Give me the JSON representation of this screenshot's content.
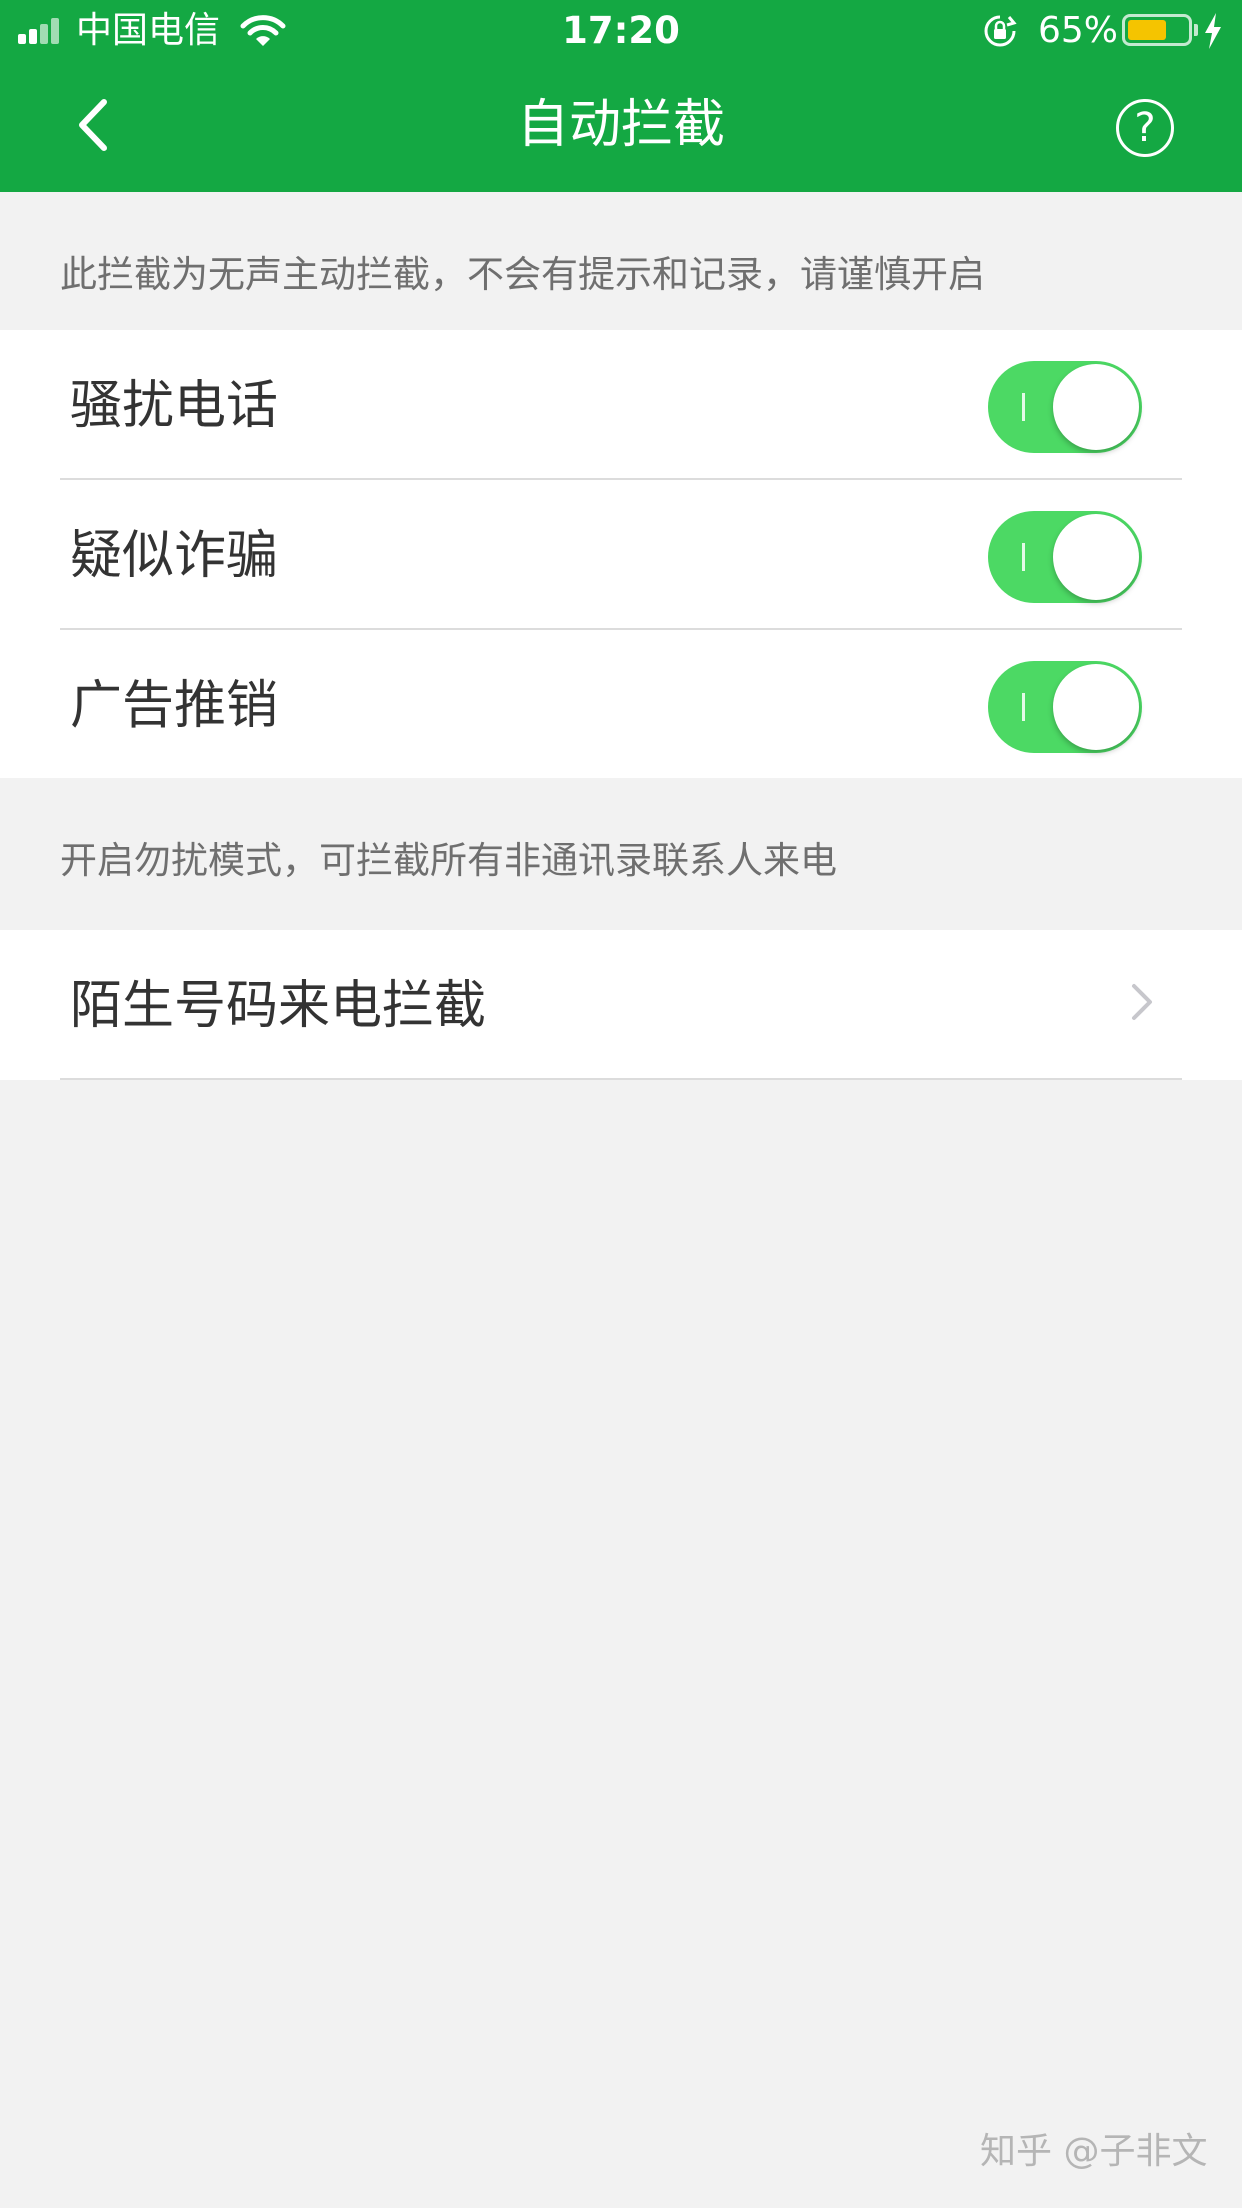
{
  "status_bar": {
    "carrier": "中国电信",
    "time": "17:20",
    "battery_percent": "65%",
    "battery_level": 0.65,
    "battery_color": "#f5c400"
  },
  "nav": {
    "title": "自动拦截",
    "back_icon": "chevron-left-icon",
    "help_label": "?",
    "bar_color": "#14a843"
  },
  "section1": {
    "hint": "此拦截为无声主动拦截，不会有提示和记录，请谨慎开启",
    "items": [
      {
        "label": "骚扰电话",
        "enabled": true
      },
      {
        "label": "疑似诈骗",
        "enabled": true
      },
      {
        "label": "广告推销",
        "enabled": true
      }
    ]
  },
  "section2": {
    "hint": "开启勿扰模式，可拦截所有非通讯录联系人来电",
    "items": [
      {
        "label": "陌生号码来电拦截"
      }
    ]
  },
  "toggle_on_color": "#4cd964",
  "watermark": "知乎 @子非文"
}
